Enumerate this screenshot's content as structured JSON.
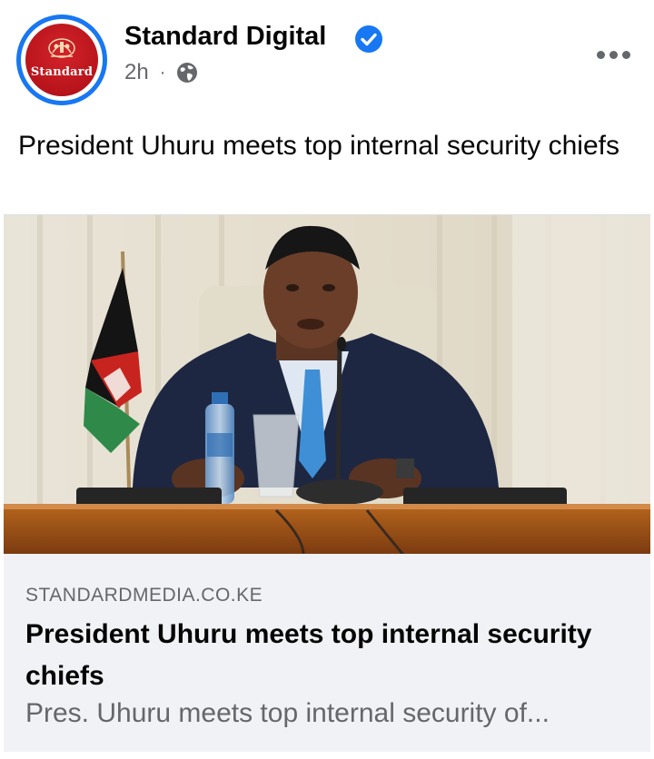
{
  "post": {
    "page_name": "Standard Digital",
    "verified": true,
    "timestamp": "2h",
    "separator": "·",
    "audience_icon": "globe-icon",
    "caption": "President Uhuru meets top internal security chiefs",
    "avatar": {
      "logo_text": "Standard",
      "logo_color": "#c4161c",
      "ring_color": "#1877f2"
    }
  },
  "link_preview": {
    "domain": "STANDARDMEDIA.CO.KE",
    "title": "President Uhuru meets top internal security chiefs",
    "description": "Pres. Uhuru meets top internal security of..."
  },
  "colors": {
    "accent": "#1877f2",
    "secondary_text": "#65676b",
    "preview_bg": "#f0f2f5"
  }
}
